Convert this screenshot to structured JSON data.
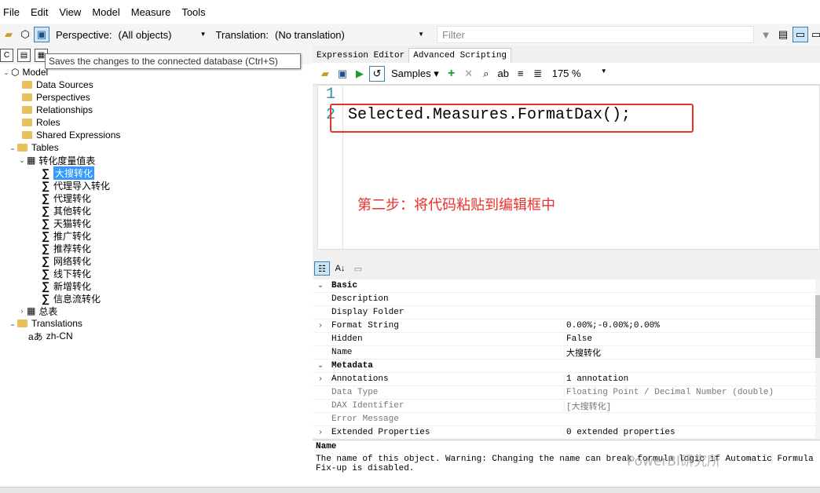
{
  "menu": [
    "File",
    "Edit",
    "View",
    "Model",
    "Measure",
    "Tools"
  ],
  "toolbar": {
    "perspective_label": "Perspective:",
    "perspective_value": "(All objects)",
    "translation_label": "Translation:",
    "translation_value": "(No translation)",
    "filter_placeholder": "Filter"
  },
  "tooltip": "Saves the changes to the connected database (Ctrl+S)",
  "tree": {
    "model": "Model",
    "data_sources": "Data Sources",
    "perspectives": "Perspectives",
    "relationships": "Relationships",
    "roles": "Roles",
    "shared_expressions": "Shared Expressions",
    "tables": "Tables",
    "table1": "转化度量值表",
    "measures": [
      "大搜转化",
      "代理导入转化",
      "代理转化",
      "其他转化",
      "天猫转化",
      "推广转化",
      "推荐转化",
      "网络转化",
      "线下转化",
      "新增转化",
      "信息流转化"
    ],
    "table2": "总表",
    "translations": "Translations",
    "culture": "zh-CN"
  },
  "tabs": [
    "Expression Editor",
    "Advanced Scripting"
  ],
  "editor_toolbar": {
    "samples": "Samples",
    "zoom": "175 %"
  },
  "editor": {
    "line1": "1",
    "line2": "2",
    "code": "Selected.Measures.FormatDax();",
    "annotation": "第二步：将代码粘贴到编辑框中"
  },
  "properties": {
    "basic": "Basic",
    "description": "Description",
    "display_folder": "Display Folder",
    "format_string": "Format String",
    "format_string_value": "0.00%;-0.00%;0.00%",
    "hidden": "Hidden",
    "hidden_value": "False",
    "name": "Name",
    "name_value": "大搜转化",
    "metadata": "Metadata",
    "annotations": "Annotations",
    "annotations_value": "1 annotation",
    "data_type": "Data Type",
    "data_type_value": "Floating Point / Decimal Number (double)",
    "dax_identifier": "DAX Identifier",
    "dax_identifier_value": "[大搜转化]",
    "error_message": "Error Message",
    "extended_properties": "Extended Properties",
    "extended_properties_value": "0 extended properties"
  },
  "description_panel": {
    "title": "Name",
    "text": "The name of this object. Warning: Changing the name can break formula logic if Automatic Formula Fix-up is disabled.",
    "watermark": "PowerBI研究所"
  }
}
